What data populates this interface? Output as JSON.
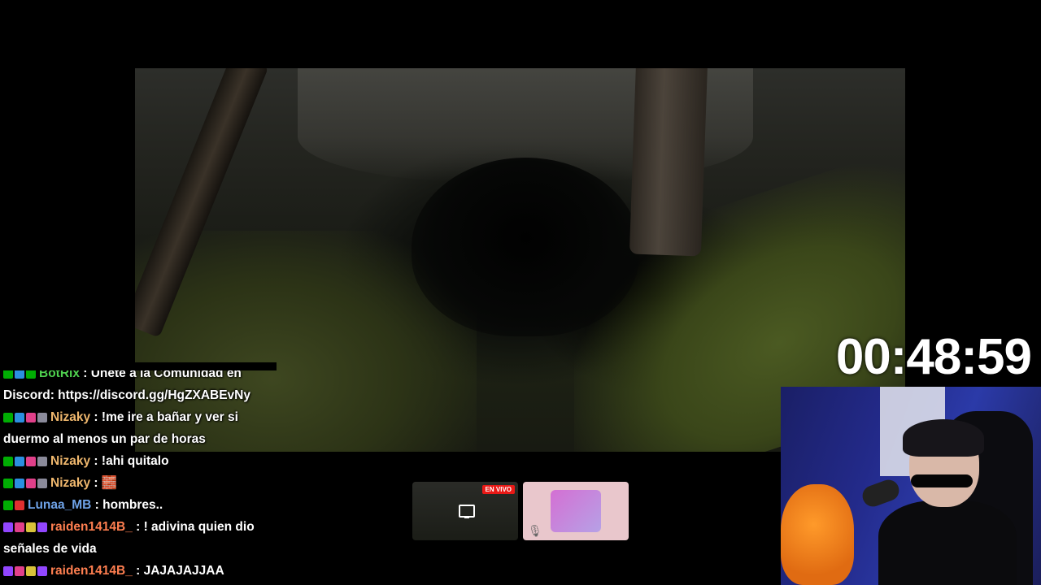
{
  "timer": "00:48:59",
  "preview": {
    "live_badge": "EN VIVO"
  },
  "chat": [
    {
      "badges": [
        "mod",
        "prime",
        "verified"
      ],
      "badge_colors": [
        "#00ad03",
        "#2b8fe0",
        "#00ad03"
      ],
      "user": "BotRix",
      "user_color": "#4fd14f",
      "text": "Únete a la Comunidad en Discord: https://discord.gg/HgZXABEvNy"
    },
    {
      "badges": [
        "mod",
        "prime",
        "gift",
        "sub"
      ],
      "badge_colors": [
        "#00ad03",
        "#2b8fe0",
        "#e0408a",
        "#8a8a9a"
      ],
      "user": "Nizaky",
      "user_color": "#f0b86e",
      "text": "!me ire a bañar y ver si duermo al menos un par de horas"
    },
    {
      "badges": [
        "mod",
        "prime",
        "gift",
        "sub"
      ],
      "badge_colors": [
        "#00ad03",
        "#2b8fe0",
        "#e0408a",
        "#8a8a9a"
      ],
      "user": "Nizaky",
      "user_color": "#f0b86e",
      "text": "!ahi quitalo"
    },
    {
      "badges": [
        "mod",
        "prime",
        "gift",
        "sub"
      ],
      "badge_colors": [
        "#00ad03",
        "#2b8fe0",
        "#e0408a",
        "#8a8a9a"
      ],
      "user": "Nizaky",
      "user_color": "#f0b86e",
      "text": "",
      "emote": true
    },
    {
      "badges": [
        "mod",
        "heart"
      ],
      "badge_colors": [
        "#00ad03",
        "#e03030"
      ],
      "user": "Lunaa_MB",
      "user_color": "#6fa3e8",
      "text": "hombres.."
    },
    {
      "badges": [
        "prime",
        "heart",
        "bits",
        "sub"
      ],
      "badge_colors": [
        "#9146ff",
        "#e0408a",
        "#d8c23a",
        "#9146ff"
      ],
      "user": "raiden1414B_",
      "user_color": "#ff7f50",
      "text": "! adivina quien dio señales de vida"
    },
    {
      "badges": [
        "prime",
        "heart",
        "bits",
        "sub"
      ],
      "badge_colors": [
        "#9146ff",
        "#e0408a",
        "#d8c23a",
        "#9146ff"
      ],
      "user": "raiden1414B_",
      "user_color": "#ff7f50",
      "text": "JAJAJAJJAA"
    }
  ]
}
